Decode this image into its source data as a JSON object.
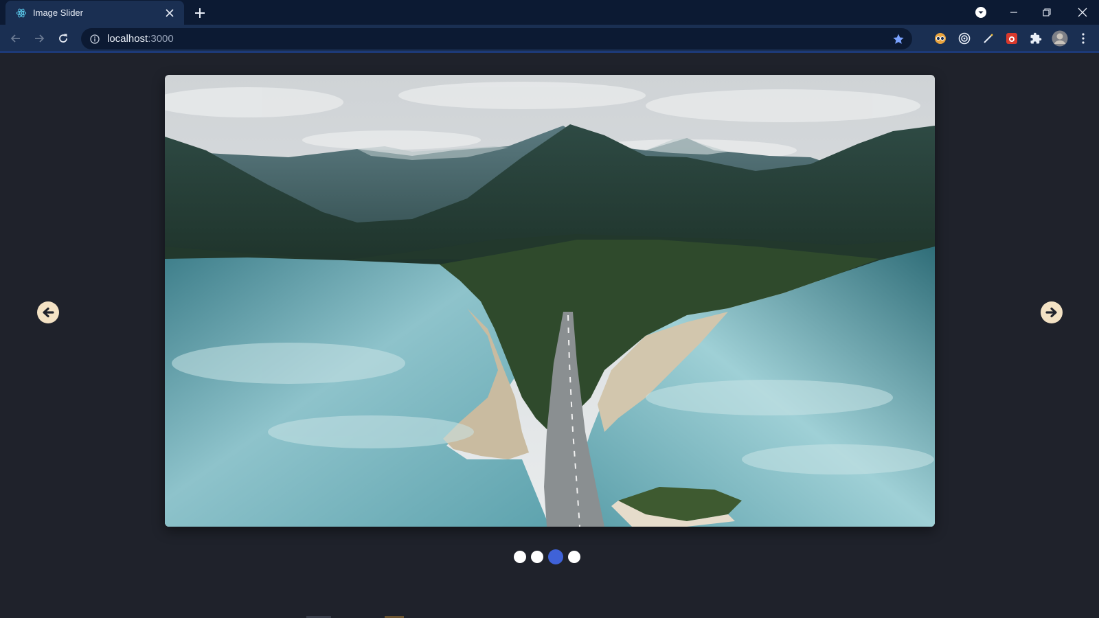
{
  "browser": {
    "tab_title": "Image Slider",
    "url_host": "localhost",
    "url_port": ":3000"
  },
  "slider": {
    "image_alt": "Aerial view of a road crossing a turquoise mountain lake",
    "dot_count": 4,
    "active_index": 2,
    "prev_icon": "arrow-left-circle-icon",
    "next_icon": "arrow-right-circle-icon"
  },
  "colors": {
    "page_bg": "#1f222b",
    "arrow_bg": "#f3e2c4",
    "dot_inactive": "#ffffff",
    "dot_active": "#3f62d8"
  }
}
